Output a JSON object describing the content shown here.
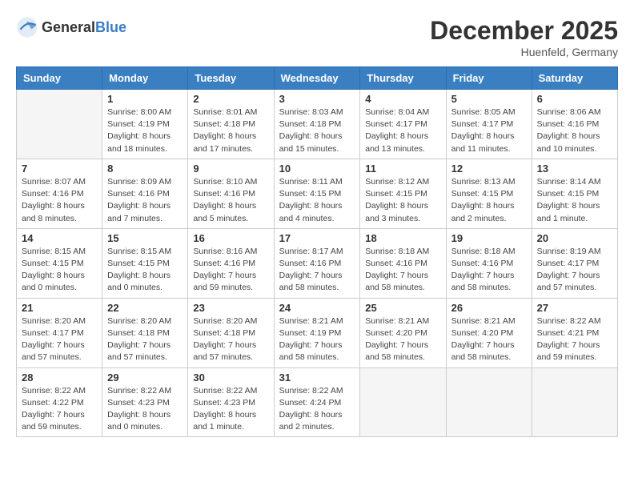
{
  "header": {
    "logo_general": "General",
    "logo_blue": "Blue",
    "title": "December 2025",
    "location": "Huenfeld, Germany"
  },
  "columns": [
    "Sunday",
    "Monday",
    "Tuesday",
    "Wednesday",
    "Thursday",
    "Friday",
    "Saturday"
  ],
  "weeks": [
    [
      {
        "day": "",
        "empty": true
      },
      {
        "day": "1",
        "sunrise": "Sunrise: 8:00 AM",
        "sunset": "Sunset: 4:19 PM",
        "daylight": "Daylight: 8 hours and 18 minutes."
      },
      {
        "day": "2",
        "sunrise": "Sunrise: 8:01 AM",
        "sunset": "Sunset: 4:18 PM",
        "daylight": "Daylight: 8 hours and 17 minutes."
      },
      {
        "day": "3",
        "sunrise": "Sunrise: 8:03 AM",
        "sunset": "Sunset: 4:18 PM",
        "daylight": "Daylight: 8 hours and 15 minutes."
      },
      {
        "day": "4",
        "sunrise": "Sunrise: 8:04 AM",
        "sunset": "Sunset: 4:17 PM",
        "daylight": "Daylight: 8 hours and 13 minutes."
      },
      {
        "day": "5",
        "sunrise": "Sunrise: 8:05 AM",
        "sunset": "Sunset: 4:17 PM",
        "daylight": "Daylight: 8 hours and 11 minutes."
      },
      {
        "day": "6",
        "sunrise": "Sunrise: 8:06 AM",
        "sunset": "Sunset: 4:16 PM",
        "daylight": "Daylight: 8 hours and 10 minutes."
      }
    ],
    [
      {
        "day": "7",
        "sunrise": "Sunrise: 8:07 AM",
        "sunset": "Sunset: 4:16 PM",
        "daylight": "Daylight: 8 hours and 8 minutes."
      },
      {
        "day": "8",
        "sunrise": "Sunrise: 8:09 AM",
        "sunset": "Sunset: 4:16 PM",
        "daylight": "Daylight: 8 hours and 7 minutes."
      },
      {
        "day": "9",
        "sunrise": "Sunrise: 8:10 AM",
        "sunset": "Sunset: 4:16 PM",
        "daylight": "Daylight: 8 hours and 5 minutes."
      },
      {
        "day": "10",
        "sunrise": "Sunrise: 8:11 AM",
        "sunset": "Sunset: 4:15 PM",
        "daylight": "Daylight: 8 hours and 4 minutes."
      },
      {
        "day": "11",
        "sunrise": "Sunrise: 8:12 AM",
        "sunset": "Sunset: 4:15 PM",
        "daylight": "Daylight: 8 hours and 3 minutes."
      },
      {
        "day": "12",
        "sunrise": "Sunrise: 8:13 AM",
        "sunset": "Sunset: 4:15 PM",
        "daylight": "Daylight: 8 hours and 2 minutes."
      },
      {
        "day": "13",
        "sunrise": "Sunrise: 8:14 AM",
        "sunset": "Sunset: 4:15 PM",
        "daylight": "Daylight: 8 hours and 1 minute."
      }
    ],
    [
      {
        "day": "14",
        "sunrise": "Sunrise: 8:15 AM",
        "sunset": "Sunset: 4:15 PM",
        "daylight": "Daylight: 8 hours and 0 minutes."
      },
      {
        "day": "15",
        "sunrise": "Sunrise: 8:15 AM",
        "sunset": "Sunset: 4:15 PM",
        "daylight": "Daylight: 8 hours and 0 minutes."
      },
      {
        "day": "16",
        "sunrise": "Sunrise: 8:16 AM",
        "sunset": "Sunset: 4:16 PM",
        "daylight": "Daylight: 7 hours and 59 minutes."
      },
      {
        "day": "17",
        "sunrise": "Sunrise: 8:17 AM",
        "sunset": "Sunset: 4:16 PM",
        "daylight": "Daylight: 7 hours and 58 minutes."
      },
      {
        "day": "18",
        "sunrise": "Sunrise: 8:18 AM",
        "sunset": "Sunset: 4:16 PM",
        "daylight": "Daylight: 7 hours and 58 minutes."
      },
      {
        "day": "19",
        "sunrise": "Sunrise: 8:18 AM",
        "sunset": "Sunset: 4:16 PM",
        "daylight": "Daylight: 7 hours and 58 minutes."
      },
      {
        "day": "20",
        "sunrise": "Sunrise: 8:19 AM",
        "sunset": "Sunset: 4:17 PM",
        "daylight": "Daylight: 7 hours and 57 minutes."
      }
    ],
    [
      {
        "day": "21",
        "sunrise": "Sunrise: 8:20 AM",
        "sunset": "Sunset: 4:17 PM",
        "daylight": "Daylight: 7 hours and 57 minutes."
      },
      {
        "day": "22",
        "sunrise": "Sunrise: 8:20 AM",
        "sunset": "Sunset: 4:18 PM",
        "daylight": "Daylight: 7 hours and 57 minutes."
      },
      {
        "day": "23",
        "sunrise": "Sunrise: 8:20 AM",
        "sunset": "Sunset: 4:18 PM",
        "daylight": "Daylight: 7 hours and 57 minutes."
      },
      {
        "day": "24",
        "sunrise": "Sunrise: 8:21 AM",
        "sunset": "Sunset: 4:19 PM",
        "daylight": "Daylight: 7 hours and 58 minutes."
      },
      {
        "day": "25",
        "sunrise": "Sunrise: 8:21 AM",
        "sunset": "Sunset: 4:20 PM",
        "daylight": "Daylight: 7 hours and 58 minutes."
      },
      {
        "day": "26",
        "sunrise": "Sunrise: 8:21 AM",
        "sunset": "Sunset: 4:20 PM",
        "daylight": "Daylight: 7 hours and 58 minutes."
      },
      {
        "day": "27",
        "sunrise": "Sunrise: 8:22 AM",
        "sunset": "Sunset: 4:21 PM",
        "daylight": "Daylight: 7 hours and 59 minutes."
      }
    ],
    [
      {
        "day": "28",
        "sunrise": "Sunrise: 8:22 AM",
        "sunset": "Sunset: 4:22 PM",
        "daylight": "Daylight: 7 hours and 59 minutes."
      },
      {
        "day": "29",
        "sunrise": "Sunrise: 8:22 AM",
        "sunset": "Sunset: 4:23 PM",
        "daylight": "Daylight: 8 hours and 0 minutes."
      },
      {
        "day": "30",
        "sunrise": "Sunrise: 8:22 AM",
        "sunset": "Sunset: 4:23 PM",
        "daylight": "Daylight: 8 hours and 1 minute."
      },
      {
        "day": "31",
        "sunrise": "Sunrise: 8:22 AM",
        "sunset": "Sunset: 4:24 PM",
        "daylight": "Daylight: 8 hours and 2 minutes."
      },
      {
        "day": "",
        "empty": true
      },
      {
        "day": "",
        "empty": true
      },
      {
        "day": "",
        "empty": true
      }
    ]
  ]
}
